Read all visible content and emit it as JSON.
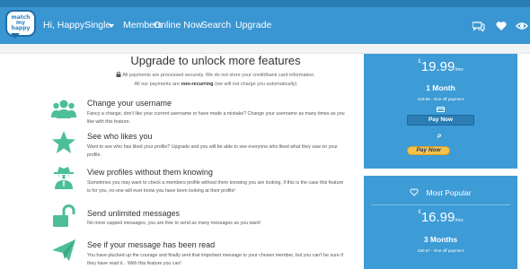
{
  "logo": {
    "line1": "match",
    "line2": "my",
    "line3": "happy"
  },
  "nav": {
    "user_menu": "Hi, HappySingle",
    "members": "Members",
    "online_now": "Online Now",
    "search": "Search",
    "upgrade": "Upgrade"
  },
  "page": {
    "title": "Upgrade to unlock more features",
    "secure_note": "All payments are processed securely. We do not store your credit/bank card information.",
    "recurring_pre": "All our payments are",
    "recurring_bold": "non-recurring",
    "recurring_post": "(we will not charge you automatically)"
  },
  "features": [
    {
      "icon": "users-icon",
      "title": "Change your username",
      "desc": "Fancy a change, don't like your current username or have made a mistake? Change your username as many times as you like with this feature."
    },
    {
      "icon": "star-icon",
      "title": "See who likes you",
      "desc": "Want to see who has liked your profile? Upgrade and you will be able to see everyone who liked what they saw on your profile."
    },
    {
      "icon": "spy-icon",
      "title": "View profiles without them knowing",
      "desc": "Sometimes you may want to check a members profile without them knowing you are looking, if this is the case this feature is for you, no-one will ever know you have been looking at their profile!"
    },
    {
      "icon": "unlock-icon",
      "title": "Send unlimited messages",
      "desc": "No more capped messages, you are free to send as many messages as you want!"
    },
    {
      "icon": "paper-plane-icon",
      "title": "See if your message has been read",
      "desc": "You have plucked up the courage and finally sent that important message to your chosen member, but you can't be sure if they have read it... With this feature you can!"
    }
  ],
  "plans": [
    {
      "currency": "£",
      "price": "19.99",
      "per": "/mo",
      "period": "1 Month",
      "subprice": "£19.99 - One off payment",
      "pay_now": "Pay Now",
      "paypal_label": "Pay Now"
    },
    {
      "badge": "Most Popular",
      "currency": "£",
      "price": "16.99",
      "per": "/mo",
      "period": "3 Months",
      "subprice": "£50.97 - One off payment"
    }
  ],
  "colors": {
    "nav_bg": "#3a96d2",
    "accent_green": "#4cbf9a",
    "card_bg": "#3d9bd6",
    "paypal_yellow": "#f5c24a"
  }
}
